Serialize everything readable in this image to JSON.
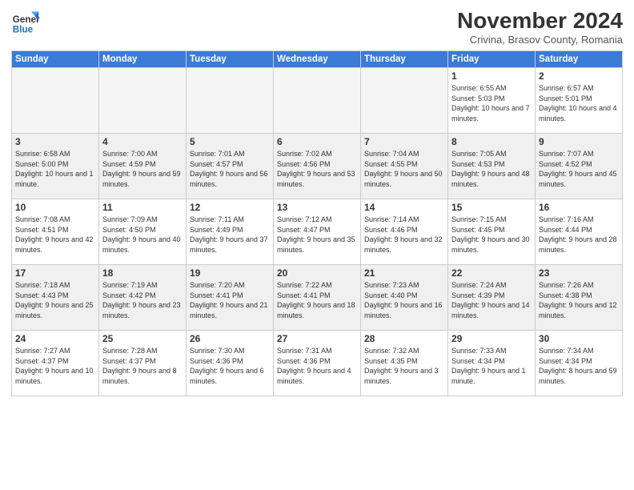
{
  "logo": {
    "line1": "General",
    "line2": "Blue"
  },
  "title": "November 2024",
  "location": "Crivina, Brasov County, Romania",
  "weekdays": [
    "Sunday",
    "Monday",
    "Tuesday",
    "Wednesday",
    "Thursday",
    "Friday",
    "Saturday"
  ],
  "weeks": [
    [
      {
        "day": "",
        "info": ""
      },
      {
        "day": "",
        "info": ""
      },
      {
        "day": "",
        "info": ""
      },
      {
        "day": "",
        "info": ""
      },
      {
        "day": "",
        "info": ""
      },
      {
        "day": "1",
        "info": "Sunrise: 6:55 AM\nSunset: 5:03 PM\nDaylight: 10 hours and 7 minutes."
      },
      {
        "day": "2",
        "info": "Sunrise: 6:57 AM\nSunset: 5:01 PM\nDaylight: 10 hours and 4 minutes."
      }
    ],
    [
      {
        "day": "3",
        "info": "Sunrise: 6:58 AM\nSunset: 5:00 PM\nDaylight: 10 hours and 1 minute."
      },
      {
        "day": "4",
        "info": "Sunrise: 7:00 AM\nSunset: 4:59 PM\nDaylight: 9 hours and 59 minutes."
      },
      {
        "day": "5",
        "info": "Sunrise: 7:01 AM\nSunset: 4:57 PM\nDaylight: 9 hours and 56 minutes."
      },
      {
        "day": "6",
        "info": "Sunrise: 7:02 AM\nSunset: 4:56 PM\nDaylight: 9 hours and 53 minutes."
      },
      {
        "day": "7",
        "info": "Sunrise: 7:04 AM\nSunset: 4:55 PM\nDaylight: 9 hours and 50 minutes."
      },
      {
        "day": "8",
        "info": "Sunrise: 7:05 AM\nSunset: 4:53 PM\nDaylight: 9 hours and 48 minutes."
      },
      {
        "day": "9",
        "info": "Sunrise: 7:07 AM\nSunset: 4:52 PM\nDaylight: 9 hours and 45 minutes."
      }
    ],
    [
      {
        "day": "10",
        "info": "Sunrise: 7:08 AM\nSunset: 4:51 PM\nDaylight: 9 hours and 42 minutes."
      },
      {
        "day": "11",
        "info": "Sunrise: 7:09 AM\nSunset: 4:50 PM\nDaylight: 9 hours and 40 minutes."
      },
      {
        "day": "12",
        "info": "Sunrise: 7:11 AM\nSunset: 4:49 PM\nDaylight: 9 hours and 37 minutes."
      },
      {
        "day": "13",
        "info": "Sunrise: 7:12 AM\nSunset: 4:47 PM\nDaylight: 9 hours and 35 minutes."
      },
      {
        "day": "14",
        "info": "Sunrise: 7:14 AM\nSunset: 4:46 PM\nDaylight: 9 hours and 32 minutes."
      },
      {
        "day": "15",
        "info": "Sunrise: 7:15 AM\nSunset: 4:45 PM\nDaylight: 9 hours and 30 minutes."
      },
      {
        "day": "16",
        "info": "Sunrise: 7:16 AM\nSunset: 4:44 PM\nDaylight: 9 hours and 28 minutes."
      }
    ],
    [
      {
        "day": "17",
        "info": "Sunrise: 7:18 AM\nSunset: 4:43 PM\nDaylight: 9 hours and 25 minutes."
      },
      {
        "day": "18",
        "info": "Sunrise: 7:19 AM\nSunset: 4:42 PM\nDaylight: 9 hours and 23 minutes."
      },
      {
        "day": "19",
        "info": "Sunrise: 7:20 AM\nSunset: 4:41 PM\nDaylight: 9 hours and 21 minutes."
      },
      {
        "day": "20",
        "info": "Sunrise: 7:22 AM\nSunset: 4:41 PM\nDaylight: 9 hours and 18 minutes."
      },
      {
        "day": "21",
        "info": "Sunrise: 7:23 AM\nSunset: 4:40 PM\nDaylight: 9 hours and 16 minutes."
      },
      {
        "day": "22",
        "info": "Sunrise: 7:24 AM\nSunset: 4:39 PM\nDaylight: 9 hours and 14 minutes."
      },
      {
        "day": "23",
        "info": "Sunrise: 7:26 AM\nSunset: 4:38 PM\nDaylight: 9 hours and 12 minutes."
      }
    ],
    [
      {
        "day": "24",
        "info": "Sunrise: 7:27 AM\nSunset: 4:37 PM\nDaylight: 9 hours and 10 minutes."
      },
      {
        "day": "25",
        "info": "Sunrise: 7:28 AM\nSunset: 4:37 PM\nDaylight: 9 hours and 8 minutes."
      },
      {
        "day": "26",
        "info": "Sunrise: 7:30 AM\nSunset: 4:36 PM\nDaylight: 9 hours and 6 minutes."
      },
      {
        "day": "27",
        "info": "Sunrise: 7:31 AM\nSunset: 4:36 PM\nDaylight: 9 hours and 4 minutes."
      },
      {
        "day": "28",
        "info": "Sunrise: 7:32 AM\nSunset: 4:35 PM\nDaylight: 9 hours and 3 minutes."
      },
      {
        "day": "29",
        "info": "Sunrise: 7:33 AM\nSunset: 4:34 PM\nDaylight: 9 hours and 1 minute."
      },
      {
        "day": "30",
        "info": "Sunrise: 7:34 AM\nSunset: 4:34 PM\nDaylight: 8 hours and 59 minutes."
      }
    ]
  ]
}
